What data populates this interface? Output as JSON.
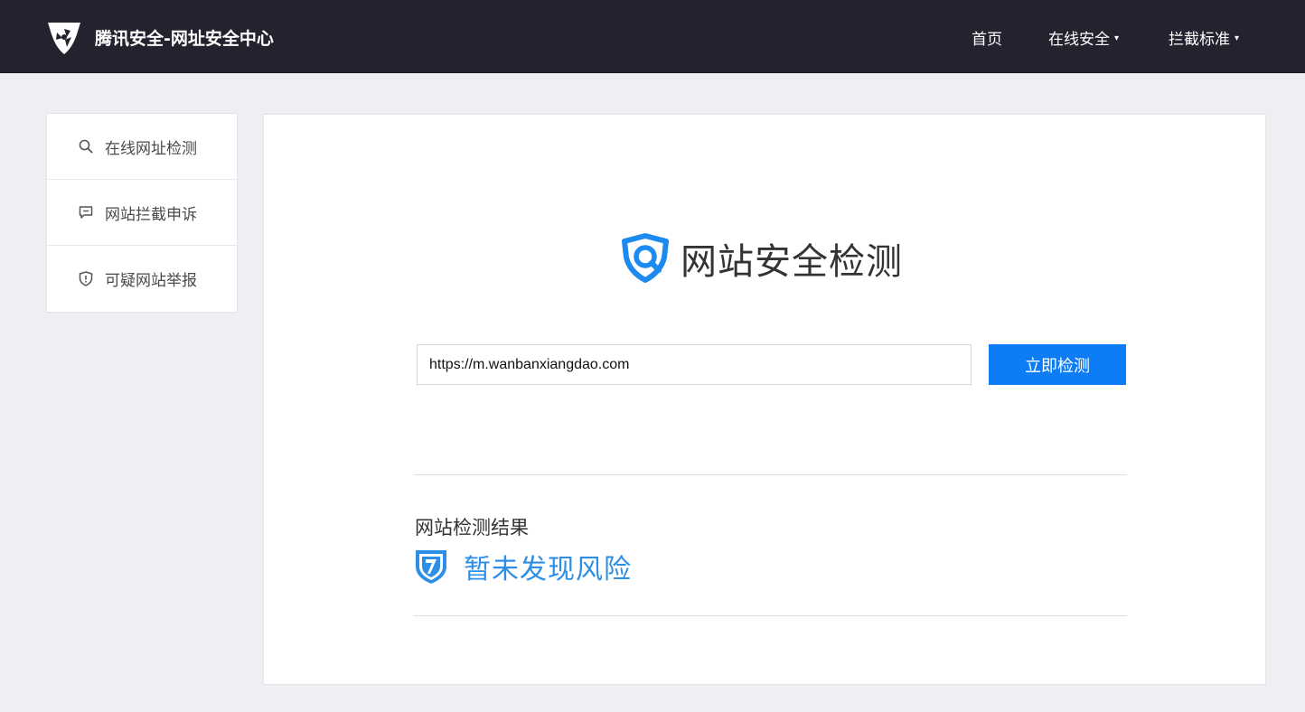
{
  "header": {
    "site_title": "腾讯安全-网址安全中心",
    "logo_icon": "tencent-security-logo",
    "nav": [
      {
        "label": "首页",
        "has_dropdown": false
      },
      {
        "label": "在线安全",
        "has_dropdown": true
      },
      {
        "label": "拦截标准",
        "has_dropdown": true
      }
    ],
    "caret": "▾"
  },
  "sidebar": {
    "items": [
      {
        "label": "在线网址检测",
        "icon": "search-icon"
      },
      {
        "label": "网站拦截申诉",
        "icon": "message-icon"
      },
      {
        "label": "可疑网站举报",
        "icon": "shield-alert-icon"
      }
    ]
  },
  "main": {
    "hero_title": "网站安全检测",
    "hero_icon": "shield-search-icon",
    "url_value": "https://m.wanbanxiangdao.com",
    "check_button": "立即检测",
    "result_heading": "网站检测结果",
    "result_status": "暂未发现风险",
    "result_icon": "safe-shield-icon"
  },
  "colors": {
    "header_bg": "#22232f",
    "page_bg": "#efeff3",
    "accent": "#0e7cf5",
    "result_text": "#2d8ee6"
  }
}
